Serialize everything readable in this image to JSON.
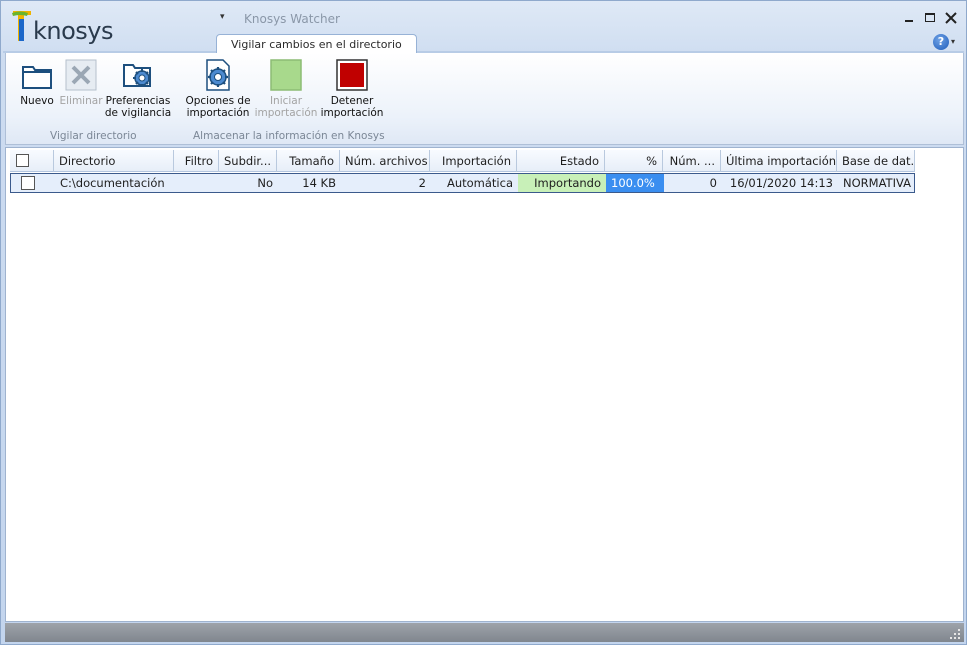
{
  "app": {
    "name": "knosys",
    "title": "Knosys Watcher"
  },
  "tab": {
    "label": "Vigilar cambios en el directorio"
  },
  "help": {
    "label": "?"
  },
  "ribbon": {
    "groups": [
      {
        "label": "Vigilar directorio"
      },
      {
        "label": "Almacenar la información en Knosys"
      }
    ],
    "buttons": {
      "nuevo": "Nuevo",
      "eliminar": "Eliminar",
      "preferencias_1": "Preferencias",
      "preferencias_2": "de vigilancia",
      "opciones_1": "Opciones de",
      "opciones_2": "importación",
      "iniciar_1": "Iniciar",
      "iniciar_2": "importación",
      "detener_1": "Detener",
      "detener_2": "importación"
    }
  },
  "grid": {
    "columns": [
      "Directorio",
      "Filtro",
      "Subdir...",
      "Tamaño",
      "Núm. archivos",
      "Importación",
      "Estado",
      "%",
      "Núm. ...",
      "Última importación",
      "Base de dat..."
    ],
    "rows": [
      {
        "directorio": "C:\\documentación",
        "filtro": "",
        "subdir": "No",
        "tamano": "14 KB",
        "num_archivos": "2",
        "importacion": "Automática",
        "estado": "Importando",
        "porcentaje": "100.0%",
        "num": "0",
        "ultima": "16/01/2020 14:13",
        "base": "NORMATIVA"
      }
    ]
  },
  "colors": {
    "estado_bg": "#c8f0b8",
    "percent_bg": "#3a8ef0",
    "stop_red": "#c00000",
    "start_green": "#a8d98c"
  }
}
